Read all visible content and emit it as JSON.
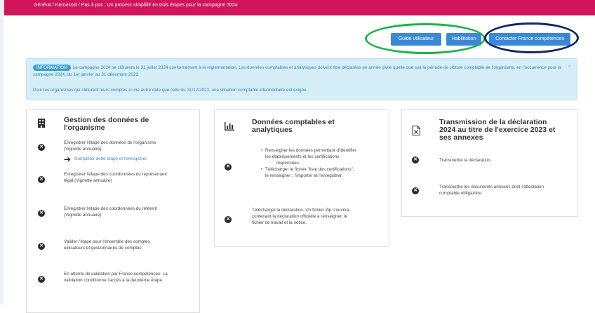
{
  "breadcrumb": {
    "items": [
      "Général",
      "Karoussel",
      "Pas à pas : Un process simplifié en trois étapes pour la campagne 2024"
    ],
    "separator": " / "
  },
  "header_buttons": {
    "guide": "Guide utilisateur",
    "habilitation": "Habilitation",
    "contact": "Contacter France compétences"
  },
  "colors": {
    "topbar": "#d1145a",
    "button": "#3b89d6",
    "ring_green": "#1fb34a",
    "ring_navy": "#0f2a63",
    "info_bg": "#d6eef8"
  },
  "info": {
    "badge": "INFORMATION",
    "line1": "La campagne 2024 se clôturera le 31 juillet 2024 conformément à la réglementation. Les données comptables et analytiques doivent être déclarées en année civile quelle que soit la période de clôture comptable de l'organisme, en l'occurrence pour la campagne 2024, du 1er janvier au 31 décembre 2023.",
    "line2": "Pour les organismes qui clôturent leurs comptes à une autre date que celle du 31/12/2023, une situation comptable intermédiaire est exigée.",
    "close": "×"
  },
  "card1": {
    "icon": "building-icon",
    "title_l1": "Gestion des données de",
    "title_l2": "l'organisme",
    "step1_l1": "Enregistrer l'étape des données de l'organisme",
    "step1_l2": "(Vignette annuaire)",
    "step1_link": "Compléter cette étape et l'enregistrer",
    "step2_l1": "Enregistrer l'étape des coordonnées du représentant",
    "step2_l2": "légal (Vignette annuaire)",
    "step3_l1": "Enregistrer l'étape des coordonnées du référent",
    "step3_l2": "(Vignette annuaire)",
    "step4_l1": "Valider l'étape pour l'ensemble des comptes",
    "step4_l2": "utilisateurs et gestionnaires de comptes",
    "step5_l1": "En attente de validation par France compétences. La",
    "step5_l2": "validation conditionne l'accès à la deuxième étape."
  },
  "card2": {
    "icon": "bar-chart-icon",
    "title_l1": "Données comptables et",
    "title_l2": "analytiques",
    "b1_l1": "Renseigner les données permettant d'identifier",
    "b1_l2": "les établissements et les certifications",
    "b1_l3": "dispensées.",
    "b2_l1": "Télécharger le fichier \"liste des certifications\",",
    "b2_l2": "le renseigner , l'importer et l'enregistrer.",
    "s2_l1": "Télécharger la déclaration. Un fichier Zip s'ouvrira",
    "s2_l2": "contenant la déclaration officielle à renseigner, le",
    "s2_l3": "fichier de travail et la notice."
  },
  "card3": {
    "icon": "excel-file-icon",
    "title_l1": "Transmission de la déclaration",
    "title_l2": "2024 au titre de l'exercice 2023 et",
    "title_l3": "ses annexes",
    "s1": "Transmettre la déclaration.",
    "s2_l1": "Transmettre les documents annexés dont l'attestation",
    "s2_l2": "comptable obligatoire."
  },
  "status_icon_glyph": "✕"
}
